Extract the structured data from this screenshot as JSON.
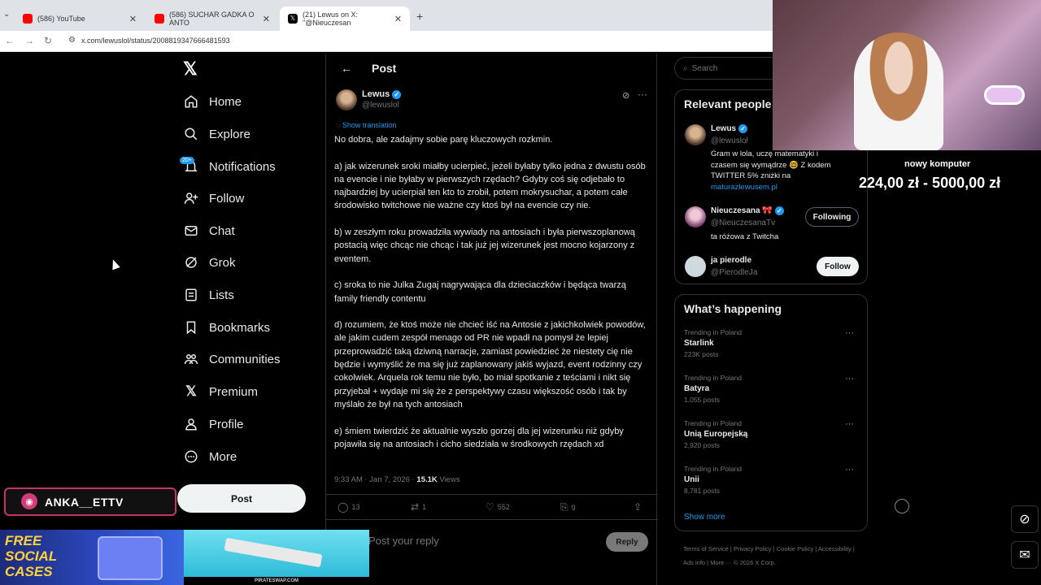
{
  "browser": {
    "tabs": [
      {
        "title": "(586) YouTube",
        "color": "#ff0000"
      },
      {
        "title": "(586) SUCHAR GADKA O ANTO",
        "color": "#ff0000"
      },
      {
        "title": "(21) Lewus on X: \"@Nieuczesan",
        "color": "#000000"
      }
    ],
    "url": "x.com/lewuslol/status/2008819347666481593"
  },
  "nav": {
    "items": [
      "Home",
      "Explore",
      "Notifications",
      "Follow",
      "Chat",
      "Grok",
      "Lists",
      "Bookmarks",
      "Communities",
      "Premium",
      "Profile",
      "More"
    ],
    "notif_badge": "20+",
    "post_button": "Post"
  },
  "post": {
    "header": "Post",
    "author": "Lewus",
    "handle": "@lewuslol",
    "show_translation": "Show translation",
    "body": "No dobra, ale zadajmy sobie parę kluczowych rozkmin.\n\na) jak wizerunek sroki miałby ucierpieć, jeżeli byłaby tylko jedna z dwustu osób na evencie i nie byłaby w pierwszych rzędach? Gdyby coś się odjebało to najbardziej by ucierpiał ten kto to zrobił, potem mokrysuchar, a potem całe środowisko twitchowe nie ważne czy ktoś był na evencie czy nie.\n\nb) w zeszłym roku prowadziła wywiady na antosiach i była pierwszoplanową postacią więc chcąc nie chcąc i tak już jej wizerunek jest mocno kojarzony z eventem.\n\nc) sroka to nie Julka Zugaj nagrywająca dla dzieciaczków i będąca twarzą family friendly contentu\n\nd) rozumiem, że ktoś może nie chcieć iść na Antosie z jakichkolwiek powodów, ale jakim cudem zespół menago od PR nie wpadł na pomysł że lepiej przeprowadzić taką dziwną narracje, zamiast powiedzieć że niestety cię nie będzie i wymyślić że ma się już zaplanowany jakiś wyjazd, event rodzinny czy cokolwiek. Arquela rok temu nie było, bo miał spotkanie z teściami i nikt się przyjebał + wydaje mi się że z perspektywy czasu większość osób i tak by myślało że był na tych antosiach\n\ne) śmiem twierdzić że aktualnie wyszło gorzej dla jej wizerunku niż gdyby pojawiła się na antosiach i cicho siedziała w środkowych rzędach xd",
    "time": "9:33 AM · Jan 7, 2026 · ",
    "views_count": "15.1K",
    "views_label": " Views",
    "replies": "13",
    "reposts": "1",
    "likes": "552",
    "bookmarks": "9",
    "reply_placeholder": "Post your reply",
    "reply_button": "Reply"
  },
  "right": {
    "search_placeholder": "Search",
    "relevant_title": "Relevant people",
    "people": [
      {
        "name": "Lewus",
        "handle": "@lewuslol",
        "bio": "Gram w lola, uczę matematyki i czasem się wymądrze 🤓 Z kodem TWITTER 5% zniżki na",
        "link": "maturazlewusem.pl"
      },
      {
        "name": "Nieuczesana 🎀",
        "handle": "@NieuczesanaTv",
        "bio": "ta różowa z Twitcha",
        "button": "Following"
      },
      {
        "name": "ja pierodle",
        "handle": "@PierodleJa",
        "button": "Follow"
      }
    ],
    "happening_title": "What’s happening",
    "trends": [
      {
        "context": "Trending in Poland",
        "title": "Starlink",
        "count": "223K posts"
      },
      {
        "context": "Trending in Poland",
        "title": "Batyra",
        "count": "1,055 posts"
      },
      {
        "context": "Trending in Poland",
        "title": "Unią Europejską",
        "count": "2,920 posts"
      },
      {
        "context": "Trending in Poland",
        "title": "Unii",
        "count": "8,781 posts"
      }
    ],
    "show_more": "Show more",
    "footer": "Terms of Service  |  Privacy Policy  |  Cookie Policy  |  Accessibility  |  Ads info  |  More ···  © 2026 X Corp."
  },
  "stream": {
    "overlay_title": "nowy komputer",
    "overlay_money": "224,00 zł - 5000,00 zł",
    "streamer": "ANKA__ETTV",
    "ad_text": "FREE SOCIAL CASES",
    "ad_site": "PIRATESWAP.COM"
  }
}
